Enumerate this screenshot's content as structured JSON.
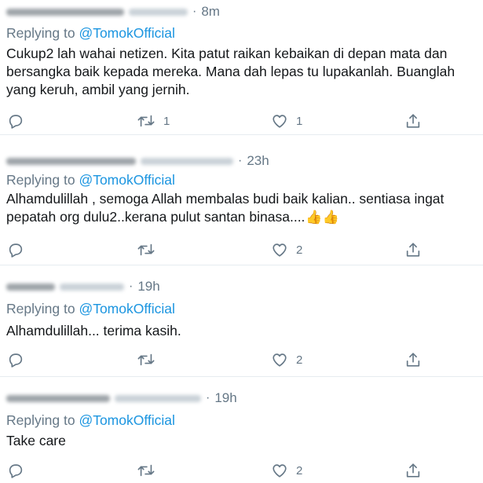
{
  "tweets": [
    {
      "time": "8m",
      "replying_prefix": "Replying to",
      "mention": "@TomokOfficial",
      "lines": [
        "Cukup2 lah wahai netizen. Kita patut raikan kebaikan di depan mata dan",
        "bersangka baik kepada mereka. Mana dah lepas tu lupakanlah. Buanglah",
        "yang keruh, ambil yang jernih."
      ],
      "retweet_count": "1",
      "like_count": "1"
    },
    {
      "time": "23h",
      "replying_prefix": "Replying to",
      "mention": "@TomokOfficial",
      "lines": [
        "Alhamdulillah , semoga Allah membalas budi baik kalian.. sentiasa ingat",
        "pepatah org dulu2..kerana pulut santan binasa...."
      ],
      "emoji": "👍👍",
      "retweet_count": "",
      "like_count": "2"
    },
    {
      "time": "19h",
      "replying_prefix": "Replying to",
      "mention": "@TomokOfficial",
      "lines": [
        "Alhamdulillah... terima kasih."
      ],
      "retweet_count": "",
      "like_count": "2"
    },
    {
      "time": "19h",
      "replying_prefix": "Replying to",
      "mention": "@TomokOfficial",
      "lines": [
        "Take care"
      ],
      "retweet_count": "",
      "like_count": "2"
    }
  ],
  "icons": [
    "reply-icon",
    "retweet-icon",
    "like-icon",
    "share-icon"
  ],
  "colors": {
    "text": "#14171a",
    "muted": "#657786",
    "link": "#1b95e0",
    "divider": "#e6ecf0"
  }
}
